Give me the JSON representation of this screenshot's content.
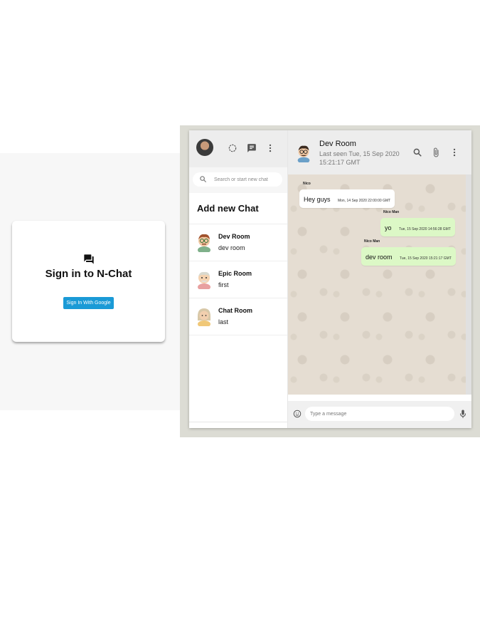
{
  "login": {
    "title": "Sign in to N-Chat",
    "button_label": "Sign In With Google",
    "icon": "chat-bubbles-icon"
  },
  "sidebar": {
    "search_placeholder": "Search or start new chat",
    "add_new_chat": "Add new Chat",
    "header_icons": [
      "status-icon",
      "new-chat-icon",
      "more-vert-icon"
    ],
    "rooms": [
      {
        "name": "Dev Room",
        "last_message": "dev room"
      },
      {
        "name": "Epic Room",
        "last_message": "first"
      },
      {
        "name": "Chat Room",
        "last_message": "last"
      }
    ]
  },
  "chat": {
    "room_name": "Dev Room",
    "last_seen": "Last seen Tue, 15 Sep 2020 15:21:17 GMT",
    "header_icons": [
      "search-icon",
      "attach-icon",
      "more-vert-icon"
    ],
    "messages": [
      {
        "sender": "Nico",
        "text": "Hey guys",
        "time": "Mon, 14 Sep 2020 22:00:00 GMT",
        "direction": "received"
      },
      {
        "sender": "Nico Man",
        "text": "yo",
        "time": "Tue, 15 Sep 2020 14:56:28 GMT",
        "direction": "sent"
      },
      {
        "sender": "Nico Man",
        "text": "dev room",
        "time": "Tue, 15 Sep 2020 15:21:17 GMT",
        "direction": "sent"
      }
    ],
    "input_placeholder": "Type a message"
  },
  "colors": {
    "accent": "#1a9ad6",
    "sent_bubble": "#dcf8c6",
    "received_bubble": "#ffffff",
    "chat_background": "#e5ddd2",
    "header_bg": "#ededed"
  }
}
